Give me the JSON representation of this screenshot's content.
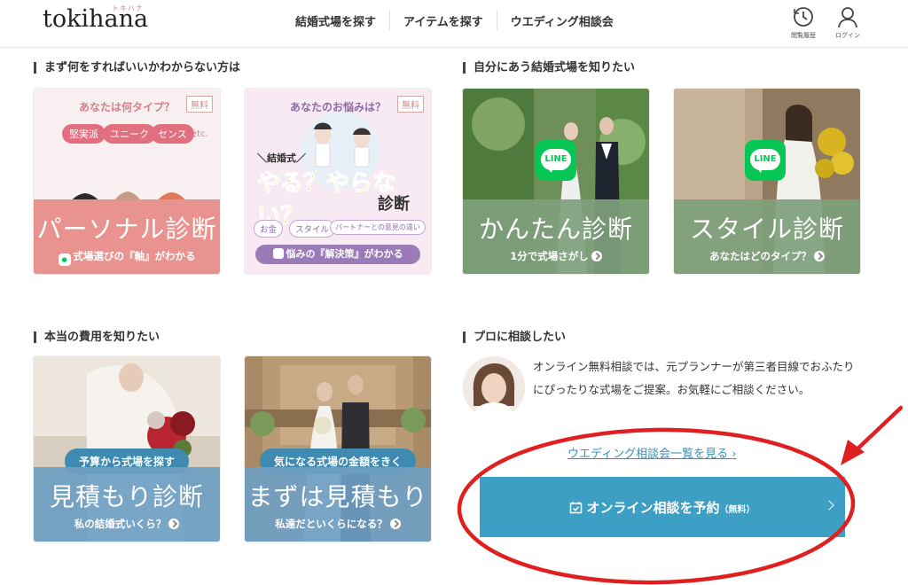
{
  "header": {
    "logo": "tokihana",
    "logo_kana": "トキハナ",
    "nav": [
      "結婚式場を探す",
      "アイテムを探す",
      "ウエディング相談会"
    ],
    "history_label": "閲覧履歴",
    "login_label": "ログイン"
  },
  "sections": {
    "unsure_title": "まず何をすればいいかわからない方は",
    "fit_title": "自分にあう結婚式場を知りたい",
    "cost_title": "本当の費用を知りたい",
    "pro_title": "プロに相談したい"
  },
  "cards": {
    "personal": {
      "question": "あなたは何タイプ？",
      "free": "無料",
      "tags": [
        "堅実派",
        "ユニーク",
        "センス"
      ],
      "etc": "etc.",
      "title": "パーソナル診断",
      "sub": "式場選びの『軸』がわかる"
    },
    "worry": {
      "question": "あなたのお悩みは？",
      "free": "無料",
      "kicker": "＼結婚式／",
      "headline": "やる？やらない？",
      "diag": "診断",
      "tags": [
        "お金",
        "スタイル",
        "パートナーとの意見の違い"
      ],
      "sub": "悩みの『解決策』がわかる"
    },
    "easy": {
      "line": "LINE",
      "title": "かんたん診断",
      "sub": "1分で式場さがし"
    },
    "style": {
      "line": "LINE",
      "title": "スタイル診断",
      "sub": "あなたはどのタイプ？"
    },
    "estimate": {
      "chip": "予算から式場を探す",
      "title": "見積もり診断",
      "sub": "私の結婚式いくら？"
    },
    "estimate2": {
      "chip": "気になる式場の金額をきく",
      "title": "まずは見積もり",
      "sub": "私達だといくらになる？"
    }
  },
  "consult": {
    "description": "オンライン無料相談では、元プランナーが第三者目線でおふたりにぴったりな式場をご提案。お気軽にご相談ください。",
    "list_link": "ウエディング相談会一覧を見る",
    "reserve_label": "オンライン相談を予約",
    "reserve_free": "（無料）"
  },
  "colors": {
    "pink_band": "#e8938f",
    "green_band": "#7e9f7c",
    "blue_band": "#6e9ec2",
    "reserve_button": "#3e9fc4",
    "annotation_red": "#e02020"
  }
}
